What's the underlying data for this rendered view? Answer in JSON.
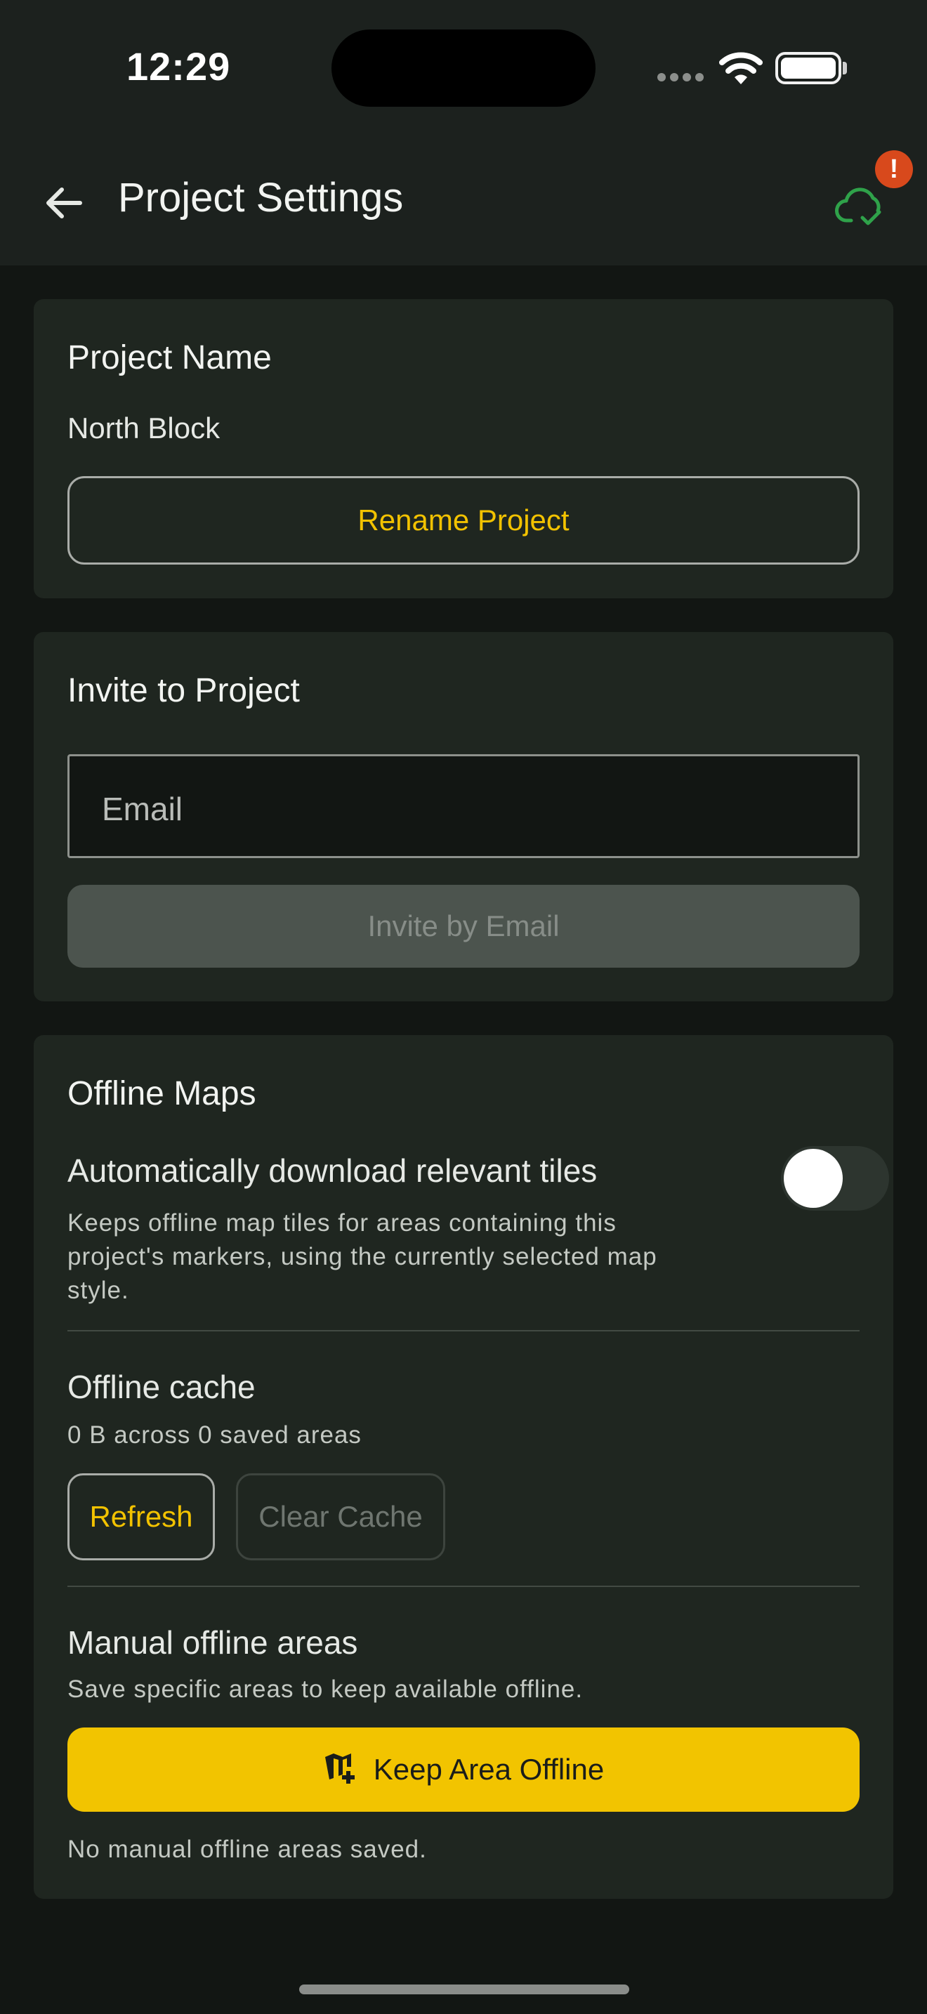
{
  "status_bar": {
    "time": "12:29"
  },
  "app_bar": {
    "title": "Project Settings",
    "badge": "!"
  },
  "project_name_card": {
    "title": "Project Name",
    "name": "North Block",
    "rename_label": "Rename Project"
  },
  "invite_card": {
    "title": "Invite to Project",
    "email_placeholder": "Email",
    "invite_label": "Invite by Email"
  },
  "offline_card": {
    "title": "Offline Maps",
    "auto_download_title": "Automatically download relevant tiles",
    "auto_download_desc": "Keeps offline map tiles for areas containing this project's markers, using the currently selected map style.",
    "auto_download_enabled": false,
    "cache_title": "Offline cache",
    "cache_summary": "0 B across 0 saved areas",
    "refresh_label": "Refresh",
    "clear_cache_label": "Clear Cache",
    "manual_title": "Manual offline areas",
    "manual_desc": "Save specific areas to keep available offline.",
    "keep_offline_label": "Keep Area Offline",
    "empty_state": "No manual offline areas saved."
  },
  "colors": {
    "accent": "#f2c400",
    "background": "#121613",
    "card": "#1f2620",
    "sync_ok": "#2fa24a",
    "alert": "#d8491c"
  }
}
